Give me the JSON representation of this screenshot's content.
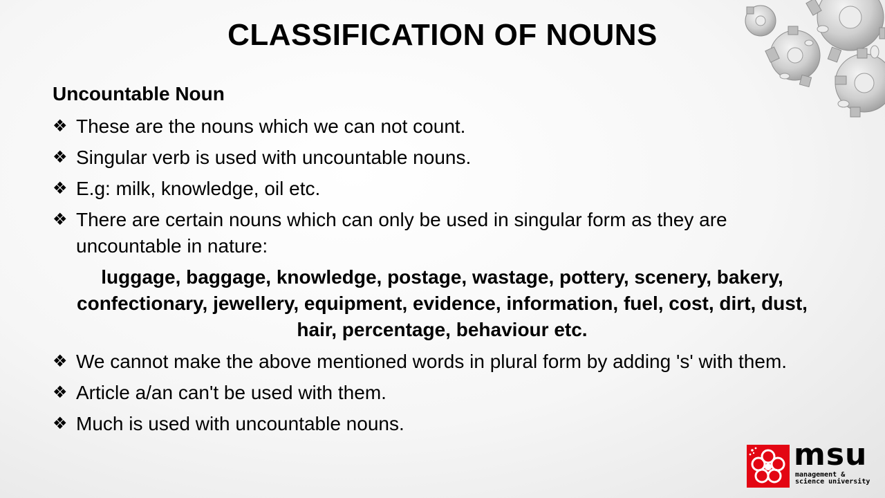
{
  "slide": {
    "title": "CLASSIFICATION OF NOUNS",
    "subheading": "Uncountable Noun",
    "bullet_glyph": "❖",
    "bullets_top": [
      "These are the nouns which we can not count.",
      "Singular verb is used with uncountable nouns.",
      "E.g: milk, knowledge, oil etc.",
      "There are certain nouns which can only be used in singular form as they are uncountable in nature:"
    ],
    "word_list": "luggage, baggage, knowledge, postage, wastage, pottery, scenery, bakery, confectionary, jewellery, equipment, evidence, information, fuel, cost, dirt, dust, hair, percentage, behaviour etc.",
    "bullets_bottom": [
      "We cannot make the above mentioned words in plural form by adding 's' with them.",
      "Article a/an can't be used with them.",
      "Much is used with uncountable nouns."
    ]
  },
  "logo": {
    "name": "msu",
    "tagline_line1": "management &",
    "tagline_line2": "science university",
    "brand_color": "#e30613"
  },
  "decoration": {
    "gears_icon": "gears-icon",
    "gear_color": "#c8c8c8"
  }
}
